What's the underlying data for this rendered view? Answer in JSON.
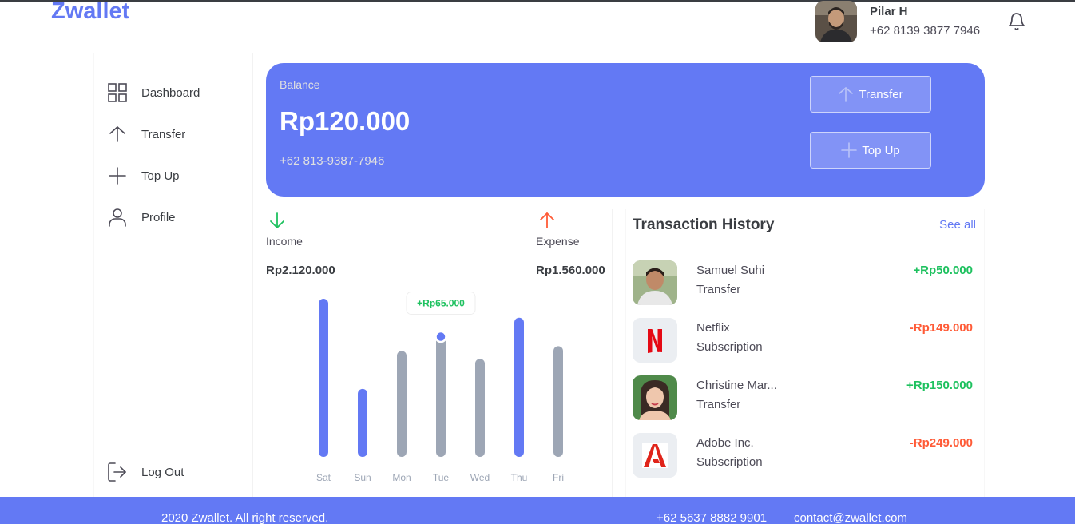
{
  "app": {
    "logo": "Zwallet"
  },
  "header": {
    "user_name": "Pilar H",
    "user_phone": "+62 8139 3877 7946",
    "icons": [
      "bell-icon"
    ]
  },
  "sidebar": {
    "items": [
      {
        "label": "Dashboard",
        "icon": "grid-icon"
      },
      {
        "label": "Transfer",
        "icon": "arrow-up-icon"
      },
      {
        "label": "Top Up",
        "icon": "plus-icon"
      },
      {
        "label": "Profile",
        "icon": "user-icon"
      }
    ],
    "logout": {
      "label": "Log Out",
      "icon": "logout-icon"
    }
  },
  "balance": {
    "label": "Balance",
    "amount": "Rp120.000",
    "phone": "+62 813-9387-7946",
    "transfer_label": "Transfer",
    "topup_label": "Top Up"
  },
  "stats": {
    "income_label": "Income",
    "income_value": "Rp2.120.000",
    "expense_label": "Expense",
    "expense_value": "Rp1.560.000",
    "income_color": "#1ec15f",
    "expense_color": "#ff5b37"
  },
  "chart_data": {
    "type": "bar",
    "categories": [
      "Sat",
      "Sun",
      "Mon",
      "Tue",
      "Wed",
      "Thu",
      "Fri"
    ],
    "values": [
      100,
      43,
      67,
      78,
      62,
      88,
      70
    ],
    "highlighted": [
      true,
      true,
      false,
      false,
      false,
      true,
      false
    ],
    "tooltip": {
      "category": "Tue",
      "label": "+Rp65.000"
    },
    "colors": {
      "highlight": "#6379f4",
      "normal": "#9da6b5"
    }
  },
  "history": {
    "title": "Transaction History",
    "see_all": "See all",
    "transactions": [
      {
        "name": "Samuel Suhi",
        "type": "Transfer",
        "amount": "+Rp50.000",
        "kind": "income"
      },
      {
        "name": "Netflix",
        "type": "Subscription",
        "amount": "-Rp149.000",
        "kind": "expense"
      },
      {
        "name": "Christine Mar...",
        "type": "Transfer",
        "amount": "+Rp150.000",
        "kind": "income"
      },
      {
        "name": "Adobe Inc.",
        "type": "Subscription",
        "amount": "-Rp249.000",
        "kind": "expense"
      }
    ]
  },
  "footer": {
    "copyright": "2020 Zwallet. All right reserved.",
    "phone": "+62 5637 8882 9901",
    "email": "contact@zwallet.com"
  }
}
